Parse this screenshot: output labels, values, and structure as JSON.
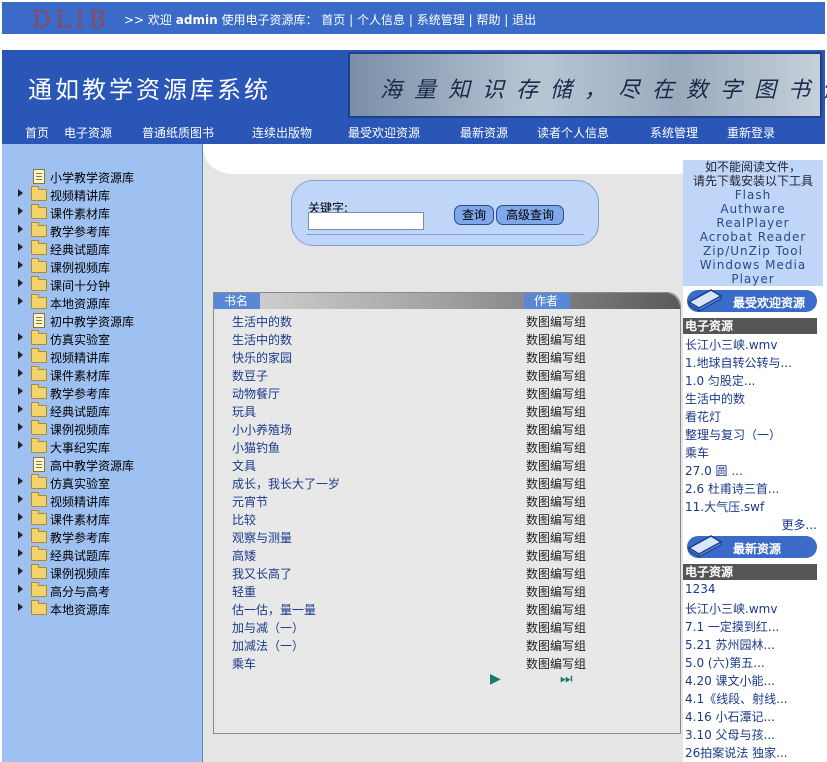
{
  "header": {
    "logo_text": "DLIB",
    "welcome_prefix": ">> 欢迎",
    "username": "admin",
    "welcome_suffix": "使用电子资源库：",
    "links": [
      "首页",
      "个人信息",
      "系统管理",
      "帮助",
      "退出"
    ],
    "separator": "|"
  },
  "banner": {
    "title": "通如教学资源库系统",
    "slogan": "海量知识存储，尽在数字图书馆"
  },
  "nav": [
    "首页",
    "电子资源",
    "普通纸质图书",
    "连续出版物",
    "最受欢迎资源",
    "最新资源",
    "读者个人信息",
    "系统管理",
    "重新登录"
  ],
  "sidebar": {
    "items": [
      {
        "label": "小学教学资源库",
        "type": "doc"
      },
      {
        "label": "视频精讲库",
        "type": "folder"
      },
      {
        "label": "课件素材库",
        "type": "folder"
      },
      {
        "label": "教学参考库",
        "type": "folder"
      },
      {
        "label": "经典试题库",
        "type": "folder"
      },
      {
        "label": "课例视频库",
        "type": "folder"
      },
      {
        "label": "课间十分钟",
        "type": "folder"
      },
      {
        "label": "本地资源库",
        "type": "folder"
      },
      {
        "label": "初中教学资源库",
        "type": "doc"
      },
      {
        "label": "仿真实验室",
        "type": "folder"
      },
      {
        "label": "视频精讲库",
        "type": "folder"
      },
      {
        "label": "课件素材库",
        "type": "folder"
      },
      {
        "label": "教学参考库",
        "type": "folder"
      },
      {
        "label": "经典试题库",
        "type": "folder"
      },
      {
        "label": "课例视频库",
        "type": "folder"
      },
      {
        "label": "大事纪实库",
        "type": "folder"
      },
      {
        "label": "高中教学资源库",
        "type": "doc"
      },
      {
        "label": "仿真实验室",
        "type": "folder"
      },
      {
        "label": "视频精讲库",
        "type": "folder"
      },
      {
        "label": "课件素材库",
        "type": "folder"
      },
      {
        "label": "教学参考库",
        "type": "folder"
      },
      {
        "label": "经典试题库",
        "type": "folder"
      },
      {
        "label": "课例视频库",
        "type": "folder"
      },
      {
        "label": "高分与高考",
        "type": "folder"
      },
      {
        "label": "本地资源库",
        "type": "folder"
      }
    ]
  },
  "search": {
    "label": "关键字:",
    "value": "",
    "query_button": "查询",
    "advanced_button": "高级查询"
  },
  "list": {
    "col_book": "书名",
    "col_author": "作者",
    "rows": [
      {
        "book": "生活中的数",
        "author": "数图编写组"
      },
      {
        "book": "生活中的数",
        "author": "数图编写组"
      },
      {
        "book": "快乐的家园",
        "author": "数图编写组"
      },
      {
        "book": "数豆子",
        "author": "数图编写组"
      },
      {
        "book": "动物餐厅",
        "author": "数图编写组"
      },
      {
        "book": "玩具",
        "author": "数图编写组"
      },
      {
        "book": "小小养殖场",
        "author": "数图编写组"
      },
      {
        "book": "小猫钓鱼",
        "author": "数图编写组"
      },
      {
        "book": "文具",
        "author": "数图编写组"
      },
      {
        "book": "成长，我长大了一岁",
        "author": "数图编写组"
      },
      {
        "book": "元宵节",
        "author": "数图编写组"
      },
      {
        "book": "比较",
        "author": "数图编写组"
      },
      {
        "book": "观察与测量",
        "author": "数图编写组"
      },
      {
        "book": "高矮",
        "author": "数图编写组"
      },
      {
        "book": "我又长高了",
        "author": "数图编写组"
      },
      {
        "book": "轻重",
        "author": "数图编写组"
      },
      {
        "book": "估一估，量一量",
        "author": "数图编写组"
      },
      {
        "book": "加与减（一）",
        "author": "数图编写组"
      },
      {
        "book": "加减法（一）",
        "author": "数图编写组"
      },
      {
        "book": "乘车",
        "author": "数图编写组"
      }
    ],
    "next_symbol": "▶",
    "last_symbol": "⏭"
  },
  "right": {
    "note_lines": [
      "如不能阅读文件，",
      "请先下载安装以下工具"
    ],
    "tools": [
      "Flash",
      "Authware",
      "RealPlayer",
      "Acrobat Reader",
      "Zip/UnZip Tool",
      "Windows Media Player"
    ],
    "popular_title": "最受欢迎资源",
    "popular_category": "电子资源",
    "popular_items": [
      "长江小三峡.wmv",
      "1.地球自转公转与...",
      "1.0 匀股定...",
      "生活中的数",
      "看花灯",
      "整理与复习（一）",
      "乘车",
      "27.0 圆 ...",
      "2.6 杜甫诗三首...",
      "11.大气压.swf"
    ],
    "more": "更多...",
    "newest_title": "最新资源",
    "newest_category": "电子资源",
    "newest_items": [
      "1234",
      "长江小三峡.wmv",
      "7.1 一定摸到红...",
      "5.21 苏州园林...",
      "5.0 (六)第五...",
      "4.20 课文小能...",
      "4.1《线段、射线...",
      "4.16 小石潭记...",
      "3.10 父母与孩...",
      "26拍案说法 独家..."
    ]
  },
  "colors": {
    "header_blue": "#3a6bc8",
    "banner_blue": "#2a56b8",
    "sidebar_bg": "#9fc1f2",
    "main_bg": "#e5e5e5",
    "link_text": "#1a3a8a"
  }
}
